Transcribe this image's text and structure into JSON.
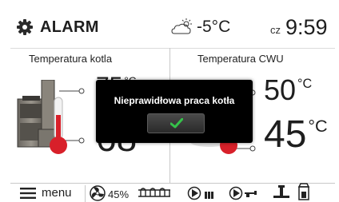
{
  "header": {
    "title": "ALARM",
    "outdoor_temp": "-5°C",
    "day": "cz",
    "time": "9:59",
    "icons": [
      "gear-icon",
      "weather-partly-cloudy-icon"
    ]
  },
  "left_panel": {
    "title": "Temperatura kotla",
    "top_value": "75",
    "top_unit": "°C",
    "bottom_value": "68",
    "bottom_unit": "°C"
  },
  "right_panel": {
    "title": "Temperatura CWU",
    "top_value": "50",
    "top_unit": "°C",
    "bottom_value": "45",
    "bottom_unit": "°C"
  },
  "bottom_bar": {
    "menu_label": "menu",
    "fan_label": "45%",
    "icons": [
      "menu-icon",
      "fan-icon",
      "heater-icon",
      "pump-radiator-icon",
      "pump-tap-icon",
      "tap-icon",
      "pellet-feeder-icon"
    ]
  },
  "dialog": {
    "message": "Nieprawidłowa praca kotła",
    "ok_icon": "checkmark-icon"
  },
  "colors": {
    "thermometer_red": "#d8202a",
    "check_green": "#35c24a",
    "dialog_bg": "#000000"
  }
}
